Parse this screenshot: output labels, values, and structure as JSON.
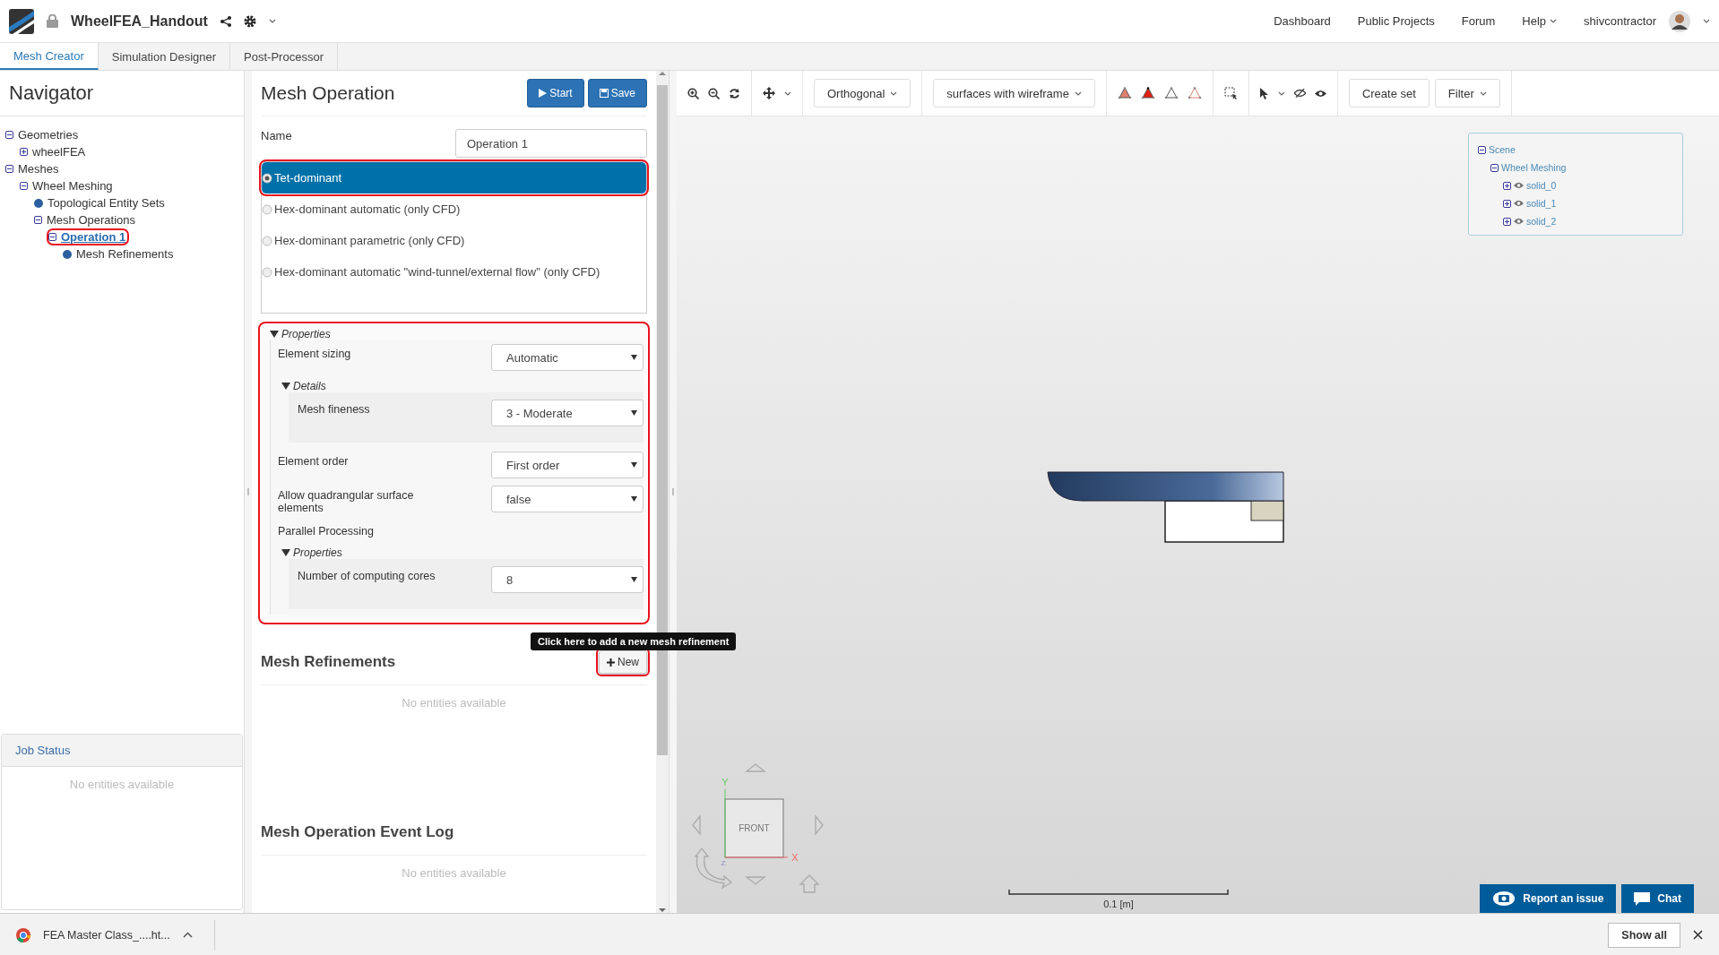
{
  "header": {
    "app_title": "WheelFEA_Handout",
    "nav_links": [
      {
        "label": "Dashboard",
        "dropdown": false
      },
      {
        "label": "Public Projects",
        "dropdown": false
      },
      {
        "label": "Forum",
        "dropdown": false
      },
      {
        "label": "Help",
        "dropdown": true
      }
    ],
    "username": "shivcontractor"
  },
  "tabs": [
    {
      "label": "Mesh Creator",
      "selected": true
    },
    {
      "label": "Simulation Designer",
      "selected": false
    },
    {
      "label": "Post-Processor",
      "selected": false
    }
  ],
  "navigator": {
    "title": "Navigator",
    "tree": [
      {
        "label": "Geometries",
        "expanded": true,
        "selected": false,
        "highlighted": false,
        "children": [
          {
            "label": "wheelFEA",
            "expanded": false,
            "selected": false,
            "highlighted": false
          }
        ]
      },
      {
        "label": "Meshes",
        "expanded": true,
        "selected": false,
        "highlighted": false,
        "children": [
          {
            "label": "Wheel Meshing",
            "expanded": true,
            "selected": false,
            "highlighted": false,
            "children": [
              {
                "label": "Topological Entity Sets",
                "selected": false,
                "highlighted": false
              },
              {
                "label": "Mesh Operations",
                "expanded": true,
                "selected": false,
                "highlighted": false,
                "children": [
                  {
                    "label": "Operation 1",
                    "expanded": true,
                    "selected": true,
                    "highlighted": true,
                    "children": [
                      {
                        "label": "Mesh Refinements",
                        "selected": false,
                        "highlighted": false
                      }
                    ]
                  }
                ]
              }
            ]
          }
        ]
      }
    ]
  },
  "job_status": {
    "title": "Job Status",
    "empty_text": "No entities available"
  },
  "mesh_operation": {
    "title": "Mesh Operation",
    "buttons": [
      {
        "label": "Start",
        "kind": "start"
      },
      {
        "label": "Save",
        "kind": "save"
      }
    ],
    "name_label": "Name",
    "name_value": "Operation 1",
    "algorithms": [
      {
        "label": "Tet-dominant",
        "selected": true,
        "highlighted": true
      },
      {
        "label": "Hex-dominant automatic (only CFD)",
        "selected": false,
        "highlighted": false
      },
      {
        "label": "Hex-dominant parametric (only CFD)",
        "selected": false,
        "highlighted": false
      },
      {
        "label": "Hex-dominant automatic \"wind-tunnel/external flow\" (only CFD)",
        "selected": false,
        "highlighted": false
      }
    ],
    "properties": {
      "title": "Properties",
      "expanded": true,
      "highlighted": true,
      "items": [
        {
          "kind": "select",
          "label": "Element sizing",
          "value": "Automatic"
        },
        {
          "kind": "group",
          "title": "Details",
          "expanded": true,
          "items": [
            {
              "kind": "select",
              "label": "Mesh fineness",
              "value": "3 - Moderate"
            }
          ]
        },
        {
          "kind": "select",
          "label": "Element order",
          "value": "First order"
        },
        {
          "kind": "select",
          "label": "Allow quadrangular surface elements",
          "value": "false"
        },
        {
          "kind": "label",
          "label": "Parallel Processing"
        },
        {
          "kind": "group",
          "title": "Properties",
          "expanded": true,
          "items": [
            {
              "kind": "select",
              "label": "Number of computing cores",
              "value": "8"
            }
          ]
        }
      ]
    }
  },
  "mesh_refinements": {
    "title": "Mesh Refinements",
    "new_button": {
      "label": "New",
      "highlighted": true
    },
    "tooltip": "Click here to add a new mesh refinement",
    "empty_text": "No entities available"
  },
  "event_log": {
    "title": "Mesh Operation Event Log",
    "empty_text": "No entities available"
  },
  "viewer": {
    "projection": "Orthogonal",
    "render_mode": "surfaces with wireframe",
    "create_set": "Create set",
    "filter": "Filter",
    "scene_tree": [
      {
        "label": "Scene",
        "expanded": true,
        "children": [
          {
            "label": "Wheel Meshing",
            "expanded": true,
            "children": [
              {
                "label": "solid_0",
                "expanded": false,
                "visible": true
              },
              {
                "label": "solid_1",
                "expanded": false,
                "visible": true
              },
              {
                "label": "solid_2",
                "expanded": false,
                "visible": true
              }
            ]
          }
        ]
      }
    ],
    "view_cube_label": "FRONT",
    "axes": {
      "y": "Y",
      "x": "X",
      "z": "Z"
    },
    "scale_label": "0.1 [m]"
  },
  "support": {
    "report": "Report an issue",
    "chat": "Chat"
  },
  "downloads_bar": {
    "file": "FEA Master Class_....ht...",
    "show_all": "Show all"
  }
}
